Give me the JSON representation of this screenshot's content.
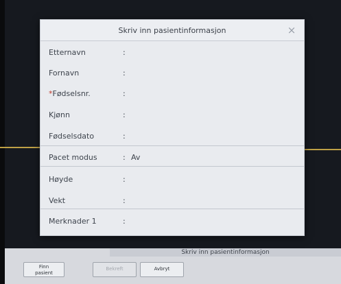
{
  "dialog": {
    "title": "Skriv inn pasientinformasjon",
    "close_symbol": "×",
    "fields": [
      {
        "label": "Etternavn",
        "required": false,
        "value": ""
      },
      {
        "label": "Fornavn",
        "required": false,
        "value": ""
      },
      {
        "label": "Fødselsnr.",
        "required": true,
        "value": ""
      },
      {
        "label": "Kjønn",
        "required": false,
        "value": ""
      },
      {
        "label": "Fødselsdato",
        "required": false,
        "value": ""
      },
      {
        "label": "Pacet modus",
        "required": false,
        "value": "Av"
      },
      {
        "label": "Høyde",
        "required": false,
        "value": ""
      },
      {
        "label": "Vekt",
        "required": false,
        "value": ""
      },
      {
        "label": "Merknader 1",
        "required": false,
        "value": ""
      }
    ],
    "colon": ":",
    "required_marker": "*"
  },
  "taskbar": {
    "title": "Skriv inn pasientinformasjon",
    "find_patient_line1": "Finn",
    "find_patient_line2": "pasient",
    "confirm": "Bekreft",
    "cancel": "Avbryt"
  },
  "colors": {
    "background": "#16191f",
    "dialog": "#e9ebef",
    "trace": "#d8b64a",
    "required": "#c0392b"
  }
}
